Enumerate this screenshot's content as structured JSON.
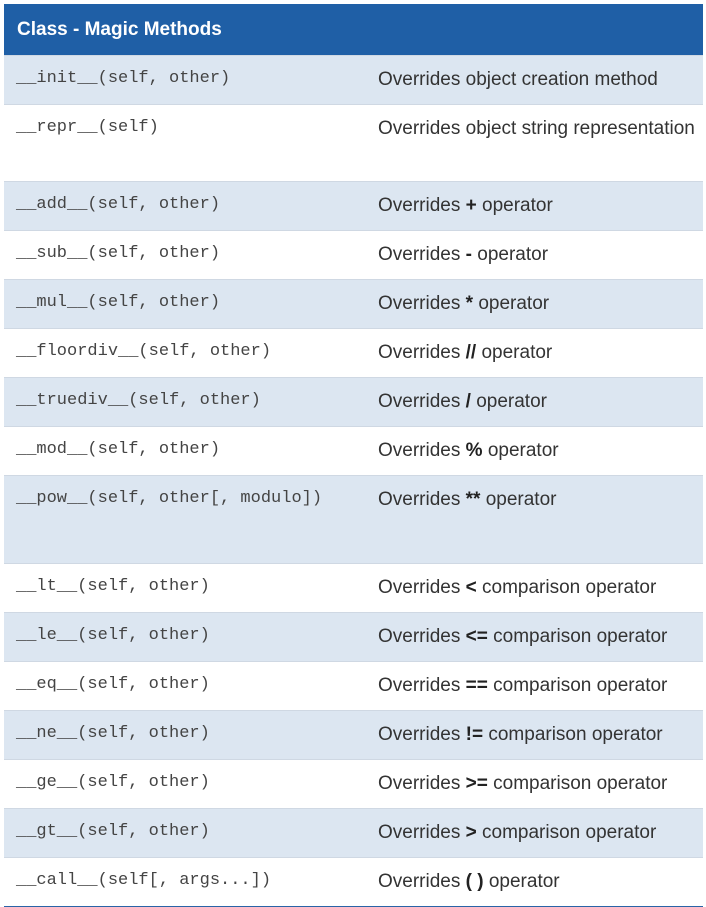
{
  "header": {
    "title": "Class - Magic Methods"
  },
  "rows": [
    {
      "sig": "__init__(self, other)",
      "pre": "Overrides object creation method",
      "op": "",
      "post": ""
    },
    {
      "sig": "__repr__(self)",
      "pre": "Overrides object string representation",
      "op": "",
      "post": ""
    },
    {
      "sig": "__add__(self, other)",
      "pre": "Overrides ",
      "op": "+",
      "post": " operator"
    },
    {
      "sig": "__sub__(self, other)",
      "pre": "Overrides ",
      "op": "-",
      "post": " operator"
    },
    {
      "sig": "__mul__(self, other)",
      "pre": "Overrides ",
      "op": "*",
      "post": " operator"
    },
    {
      "sig": "__floordiv__(self, other)",
      "pre": "Overrides ",
      "op": "//",
      "post": " operator"
    },
    {
      "sig": "__truediv__(self, other)",
      "pre": "Overrides ",
      "op": "/",
      "post": " operator"
    },
    {
      "sig": "__mod__(self, other)",
      "pre": "Overrides ",
      "op": "%",
      "post": " operator"
    },
    {
      "sig": "__pow__(self, other[, modulo])",
      "pre": "Overrides ",
      "op": "**",
      "post": " operator"
    },
    {
      "sig": "__lt__(self, other)",
      "pre": "Overrides ",
      "op": "<",
      "post": " comparison operator"
    },
    {
      "sig": "__le__(self, other)",
      "pre": "Overrides ",
      "op": "<=",
      "post": " comparison operator"
    },
    {
      "sig": "__eq__(self, other)",
      "pre": "Overrides ",
      "op": "==",
      "post": " comparison operator"
    },
    {
      "sig": "__ne__(self, other)",
      "pre": "Overrides ",
      "op": "!=",
      "post": " comparison operator"
    },
    {
      "sig": "__ge__(self, other)",
      "pre": "Overrides ",
      "op": ">=",
      "post": " comparison operator"
    },
    {
      "sig": "__gt__(self, other)",
      "pre": "Overrides ",
      "op": ">",
      "post": " comparison operator"
    },
    {
      "sig": "__call__(self[, args...])",
      "pre": "Overrides ",
      "op": "( )",
      "post": " operator"
    }
  ],
  "colors": {
    "header_bg": "#1f5fa6",
    "row_alt_bg": "#dce6f1",
    "row_bg": "#ffffff"
  }
}
